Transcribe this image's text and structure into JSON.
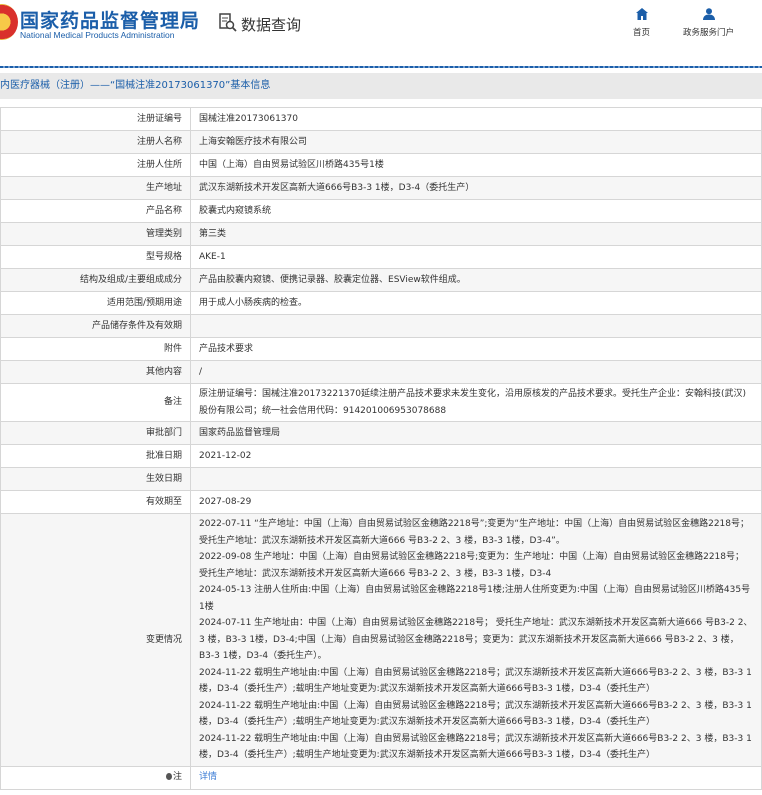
{
  "header": {
    "logo_cn": "国家药品监督管理局",
    "logo_en": "National Medical Products Administration",
    "section": "数据查询",
    "nav": [
      {
        "label": "首页",
        "icon": "home-icon"
      },
      {
        "label": "政务服务门户",
        "icon": "user-icon"
      }
    ]
  },
  "breadcrumb": "内医疗器械（注册）——“国械注准20173061370”基本信息",
  "rows": [
    {
      "label": "注册证编号",
      "value": "国械注准20173061370"
    },
    {
      "label": "注册人名称",
      "value": "上海安翰医疗技术有限公司"
    },
    {
      "label": "注册人住所",
      "value": "中国（上海）自由贸易试验区川桥路435号1楼"
    },
    {
      "label": "生产地址",
      "value": "武汉东湖新技术开发区高新大道666号B3-3 1楼，D3-4（委托生产）"
    },
    {
      "label": "产品名称",
      "value": "胶囊式内窥镜系统"
    },
    {
      "label": "管理类别",
      "value": "第三类"
    },
    {
      "label": "型号规格",
      "value": "AKE-1"
    },
    {
      "label": "结构及组成/主要组成成分",
      "value": "产品由胶囊内窥镜、便携记录器、胶囊定位器、ESView软件组成。"
    },
    {
      "label": "适用范围/预期用途",
      "value": "用于成人小肠疾病的检查。"
    },
    {
      "label": "产品储存条件及有效期",
      "value": ""
    },
    {
      "label": "附件",
      "value": "产品技术要求"
    },
    {
      "label": "其他内容",
      "value": "/"
    },
    {
      "label": "备注",
      "value": "原注册证编号：国械注准20173221370延续注册产品技术要求未发生变化，沿用原核发的产品技术要求。受托生产企业：安翰科技(武汉)股份有限公司；统一社会信用代码：914201006953078688"
    },
    {
      "label": "审批部门",
      "value": "国家药品监督管理局"
    },
    {
      "label": "批准日期",
      "value": "2021-12-02"
    },
    {
      "label": "生效日期",
      "value": ""
    },
    {
      "label": "有效期至",
      "value": "2027-08-29"
    }
  ],
  "changes": {
    "label": "变更情况",
    "entries": [
      "2022-07-11 “生产地址：中国（上海）自由贸易试验区金穗路2218号”;变更为“生产地址：中国（上海）自由贸易试验区金穗路2218号；受托生产地址：武汉东湖新技术开发区高新大道666 号B3-2 2、3 楼，B3-3 1楼，D3-4”。",
      "2022-09-08 生产地址：中国（上海）自由贸易试验区金穗路2218号;变更为：生产地址：中国（上海）自由贸易试验区金穗路2218号；",
      "受托生产地址：武汉东湖新技术开发区高新大道666 号B3-2 2、3 楼，B3-3 1楼，D3-4",
      "2024-05-13 注册人住所由:中国（上海）自由贸易试验区金穗路2218号1楼;注册人住所变更为:中国（上海）自由贸易试验区川桥路435号1楼",
      "2024-07-11 生产地址由：中国（上海）自由贸易试验区金穗路2218号； 受托生产地址：武汉东湖新技术开发区高新大道666 号B3-2 2、3 楼，B3-3 1楼，D3-4;中国（上海）自由贸易试验区金穗路2218号；变更为：武汉东湖新技术开发区高新大道666 号B3-2 2、3 楼，B3-3 1楼，D3-4（委托生产）。",
      "2024-11-22 载明生产地址由:中国（上海）自由贸易试验区金穗路2218号；武汉东湖新技术开发区高新大道666号B3-2 2、3 楼，B3-3 1楼，D3-4（委托生产）;载明生产地址变更为:武汉东湖新技术开发区高新大道666号B3-3 1楼，D3-4（委托生产）",
      "2024-11-22 载明生产地址由:中国（上海）自由贸易试验区金穗路2218号；武汉东湖新技术开发区高新大道666号B3-2 2、3 楼，B3-3 1楼，D3-4（委托生产）;载明生产地址变更为:武汉东湖新技术开发区高新大道666号B3-3 1楼，D3-4（委托生产）",
      "2024-11-22 载明生产地址由:中国（上海）自由贸易试验区金穗路2218号；武汉东湖新技术开发区高新大道666号B3-2 2、3 楼，B3-3 1楼，D3-4（委托生产）;载明生产地址变更为:武汉东湖新技术开发区高新大道666号B3-3 1楼，D3-4（委托生产）"
    ]
  },
  "note": {
    "label": "注",
    "link": "详情"
  }
}
